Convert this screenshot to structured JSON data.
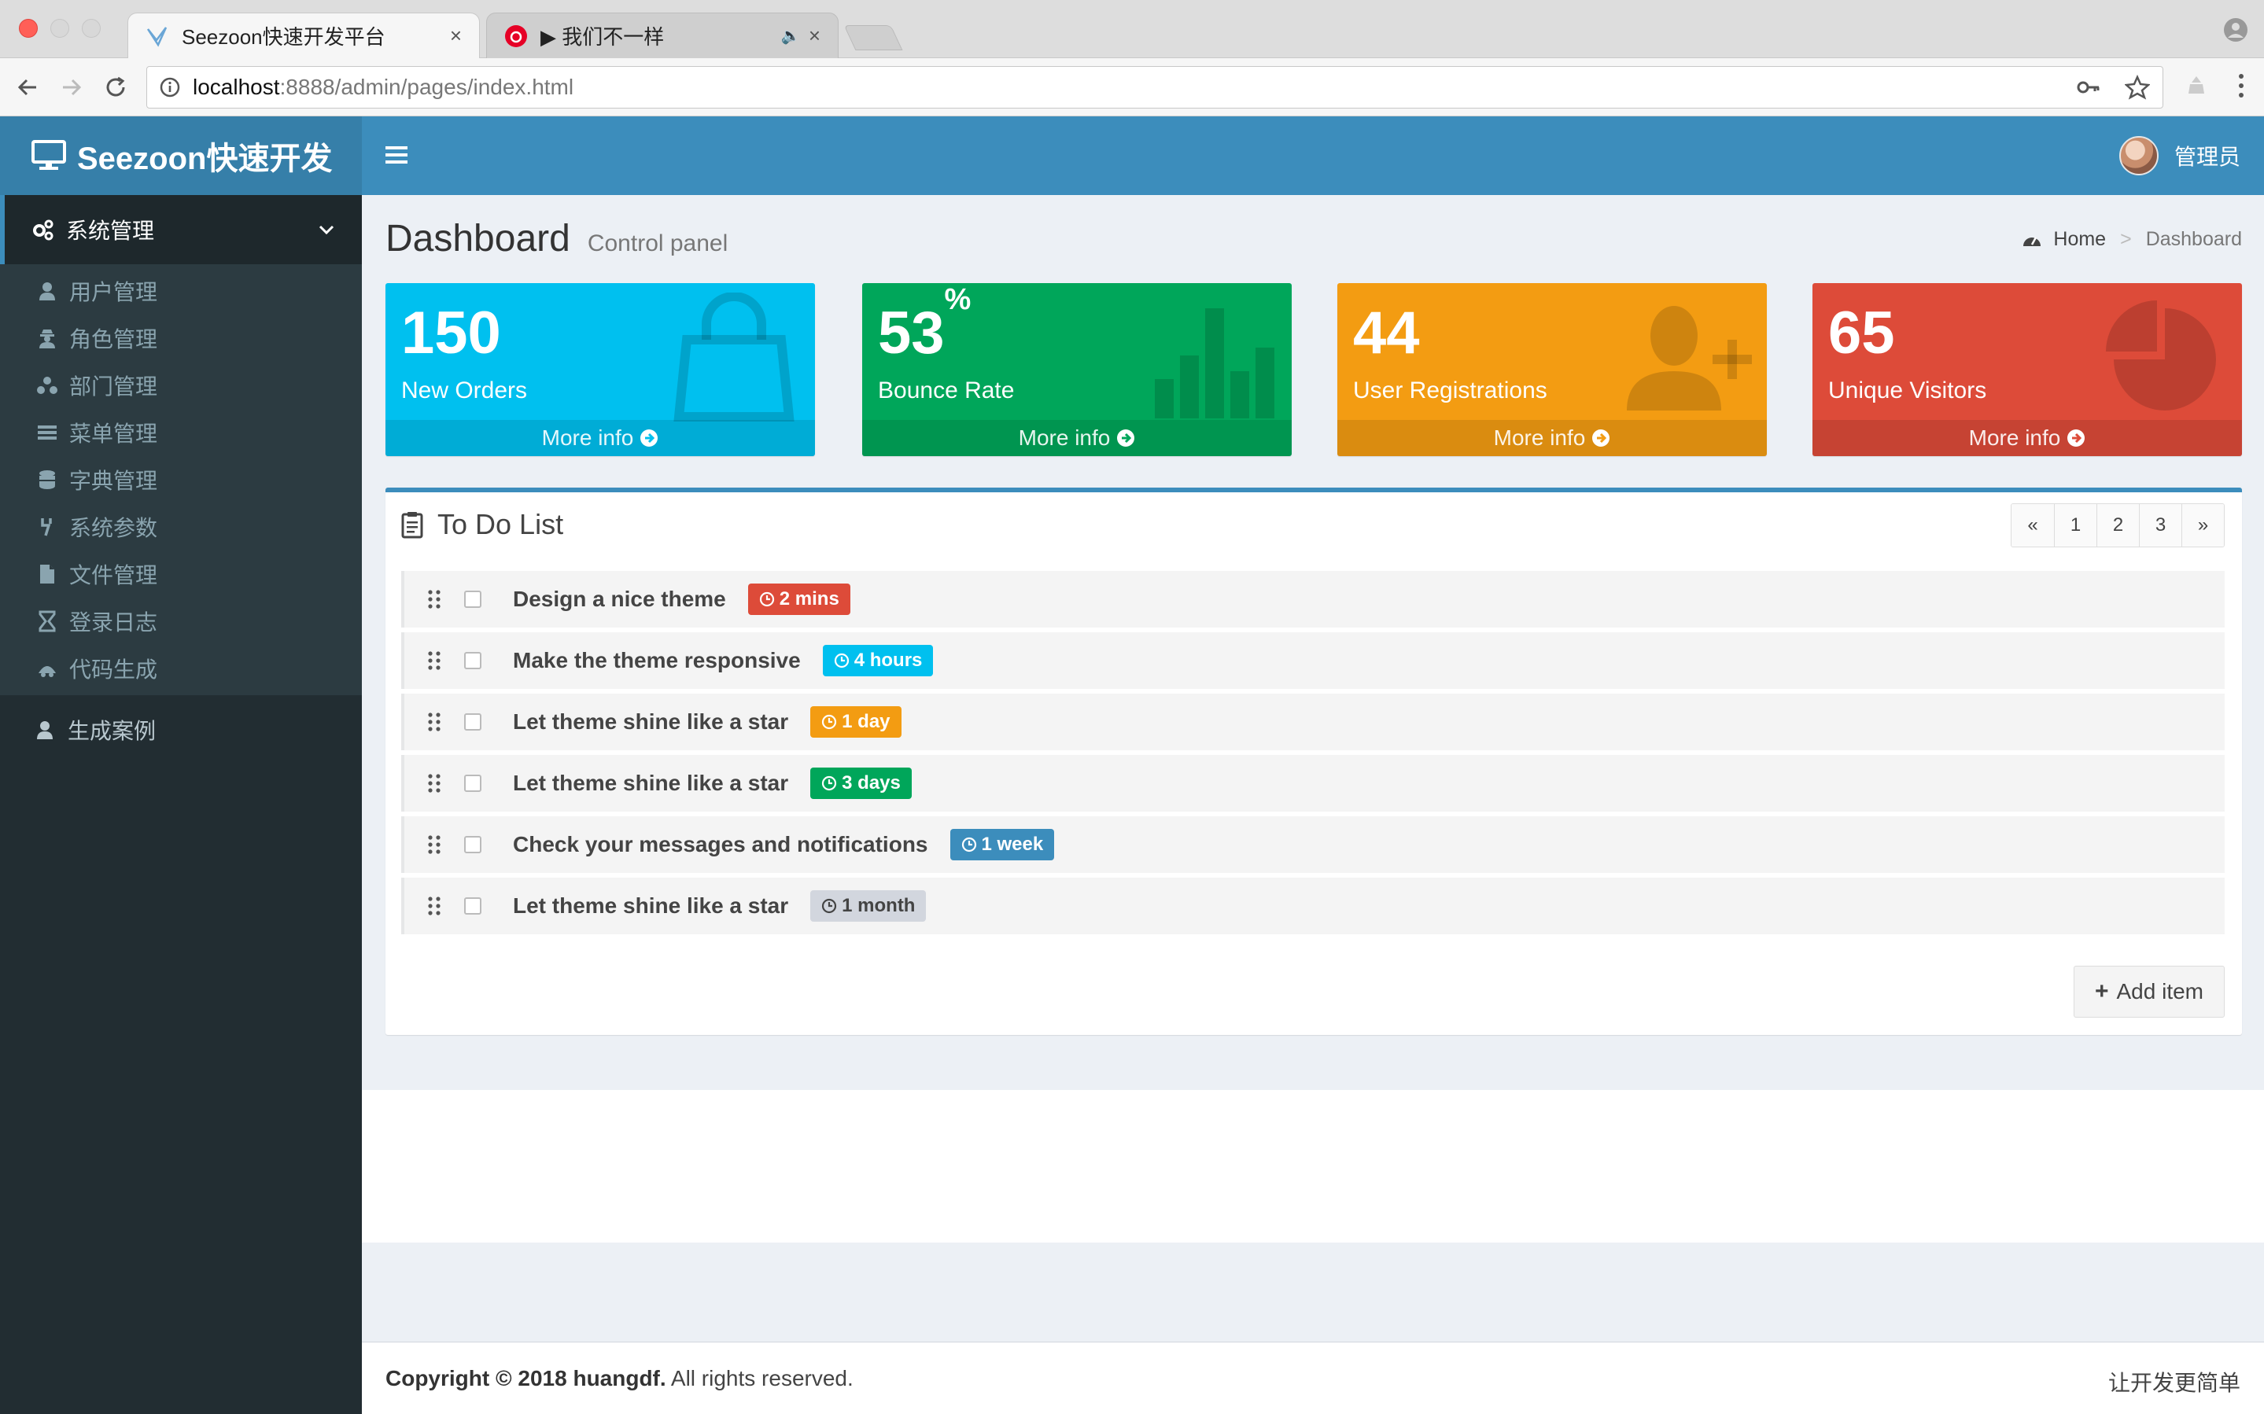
{
  "browser": {
    "tabs": [
      {
        "title": "Seezoon快速开发平台",
        "close": "×"
      },
      {
        "title": "▶ 我们不一样",
        "audio": "🔈",
        "close": "×"
      }
    ],
    "url_host": "localhost",
    "url_rest": ":8888/admin/pages/index.html"
  },
  "app": {
    "brand": "Seezoon快速开发",
    "user": "管理员"
  },
  "sidebar": {
    "header": "系统管理",
    "items": [
      {
        "label": "用户管理",
        "icon": "user-icon"
      },
      {
        "label": "角色管理",
        "icon": "user-secret-icon"
      },
      {
        "label": "部门管理",
        "icon": "sitemap-icon"
      },
      {
        "label": "菜单管理",
        "icon": "list-icon"
      },
      {
        "label": "字典管理",
        "icon": "database-icon"
      },
      {
        "label": "系统参数",
        "icon": "tools-icon"
      },
      {
        "label": "文件管理",
        "icon": "file-icon"
      },
      {
        "label": "登录日志",
        "icon": "hourglass-icon"
      },
      {
        "label": "代码生成",
        "icon": "code-icon"
      }
    ],
    "extra": "生成案例"
  },
  "content": {
    "title": "Dashboard",
    "subtitle": "Control panel",
    "breadcrumb": {
      "home": "Home",
      "sep": ">",
      "current": "Dashboard"
    }
  },
  "stats": [
    {
      "value": "150",
      "suffix": "",
      "label": "New Orders",
      "more": "More info",
      "color": "#00c0ef"
    },
    {
      "value": "53",
      "suffix": "%",
      "label": "Bounce Rate",
      "more": "More info",
      "color": "#00a65a"
    },
    {
      "value": "44",
      "suffix": "",
      "label": "User Registrations",
      "more": "More info",
      "color": "#f39c12"
    },
    {
      "value": "65",
      "suffix": "",
      "label": "Unique Visitors",
      "more": "More info",
      "color": "#dd4b39"
    }
  ],
  "todo": {
    "title": "To Do List",
    "pager": [
      "«",
      "1",
      "2",
      "3",
      "»"
    ],
    "items": [
      {
        "text": "Design a nice theme",
        "time": "2 mins",
        "color": "#dd4b39"
      },
      {
        "text": "Make the theme responsive",
        "time": "4 hours",
        "color": "#00c0ef"
      },
      {
        "text": "Let theme shine like a star",
        "time": "1 day",
        "color": "#f39c12"
      },
      {
        "text": "Let theme shine like a star",
        "time": "3 days",
        "color": "#00a65a"
      },
      {
        "text": "Check your messages and notifications",
        "time": "1 week",
        "color": "#3c8dbc"
      },
      {
        "text": "Let theme shine like a star",
        "time": "1 month",
        "color": "#d2d6de"
      }
    ],
    "add_label": "Add item"
  },
  "footer": {
    "copyright_bold": "Copyright © 2018 huangdf.",
    "copyright_rest": " All rights reserved.",
    "slogan": "让开发更简单"
  }
}
